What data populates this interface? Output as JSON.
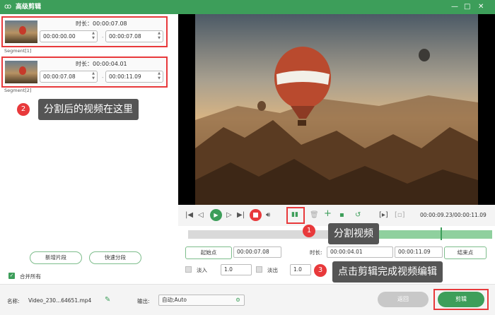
{
  "window": {
    "title": "高级剪辑",
    "logo": "rabbit-logo-icon",
    "minimize": "—",
    "maximize": "□",
    "close": "✕"
  },
  "segments": [
    {
      "duration_label": "时长：00:00:07.08",
      "start": "00:00:00.00",
      "end": "00:00:07.08",
      "label": "Segment[1]"
    },
    {
      "duration_label": "时长：00:00:04.01",
      "start": "00:00:07.08",
      "end": "00:00:11.09",
      "label": "Segment[2]"
    }
  ],
  "annotations": [
    {
      "number": "2",
      "text": "分割后的视频在这里"
    },
    {
      "number": "1",
      "text": "分割视频"
    },
    {
      "number": "3",
      "text": "点击剪辑完成视频编辑"
    }
  ],
  "left_buttons": {
    "new_segment": "新增片段",
    "quick_split": "快速分段"
  },
  "merge_all": {
    "label": "合并所有",
    "checked": true
  },
  "player": {
    "time_display": "00:00:09.23/00:00:11.09",
    "progress_fraction": 0.83,
    "timeline_color": "#8fd09e"
  },
  "edit_row": {
    "start_btn": "起始点",
    "start_value": "00:00:07.08",
    "duration_label": "时长:",
    "duration_value": "00:00:04.01",
    "end_value": "00:00:11.09",
    "end_btn": "结束点"
  },
  "fade": {
    "in_label": "淡入",
    "in_value": "1.0",
    "out_label": "淡出",
    "out_value": "1.0"
  },
  "bottom": {
    "name_label": "名称:",
    "name_value": "Video_230...64651.mp4",
    "output_label": "输出:",
    "output_value": "自动;Auto",
    "back_btn": "返回",
    "edit_btn": "剪辑"
  },
  "colors": {
    "accent": "#3d9e5a",
    "highlight": "#e8393b"
  }
}
